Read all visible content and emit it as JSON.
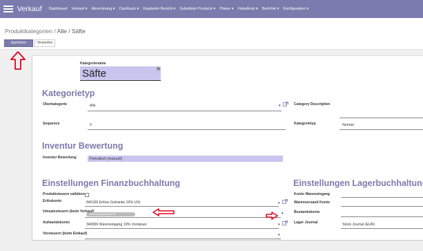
{
  "app": {
    "title": "Verkauf"
  },
  "menu": [
    "Dashboard",
    "Verkauf ▾",
    "Abrechnung ▾",
    "Cashback ▾",
    "Geplanter Bericht ▾",
    "Substitute Products ▾",
    "Planer ▾",
    "Fiskaltrust ▾",
    "Berichte ▾",
    "Konfiguration ▾"
  ],
  "breadcrumb": {
    "parent": "Produktkategorien",
    "separator": "/",
    "current": "Alle / Säfte"
  },
  "buttons": {
    "save": "Speichern",
    "discard": "Verwerfen"
  },
  "form": {
    "name_label": "Kategoriename",
    "name_value": "Säfte",
    "sections": {
      "category_type": "Kategorietyp",
      "inventory": "Inventur Bewertung",
      "accounting": "Einstellungen Finanzbuchhaltung",
      "stock": "Einstellungen Lagerbuchhaltung"
    },
    "fields": {
      "parent_label": "Oberkategorie",
      "parent_value": "Alle",
      "sequence_label": "Sequence",
      "sequence_value": "0",
      "category_description_label": "Category Description",
      "category_type_label": "Kategorietyp",
      "category_type_value": "Normal",
      "inventory_label": "Inventur Bewertung",
      "inventory_value": "Periodisch (manuell)",
      "validate_taxes_label": "Produktsteuern validieren",
      "income_label": "Erlöskonto",
      "income_value": "840100 Erlöse Getränke 19% USt",
      "sales_tax_label": "Umsatzsteuern (beim Verkauf)",
      "sales_tax_value": "19% Umsatzsteuer",
      "expense_label": "Aufwandskonto",
      "expense_value": "340000 Wareneingang 19% Vorsteuer",
      "purchase_tax_label": "Vorsteuern (beim Einkauf)",
      "stock_input_label": "Konto Wareneingang",
      "stock_output_label": "Warenversand Konto",
      "stock_valuation_label": "Bestandskonto",
      "stock_journal_label": "Lager Journal",
      "stock_journal_value": "Stock Journal (EUR)"
    }
  },
  "colors": {
    "brand": "#7c7bad",
    "highlight": "#c8c5ee",
    "arrow": "#e0001a"
  }
}
